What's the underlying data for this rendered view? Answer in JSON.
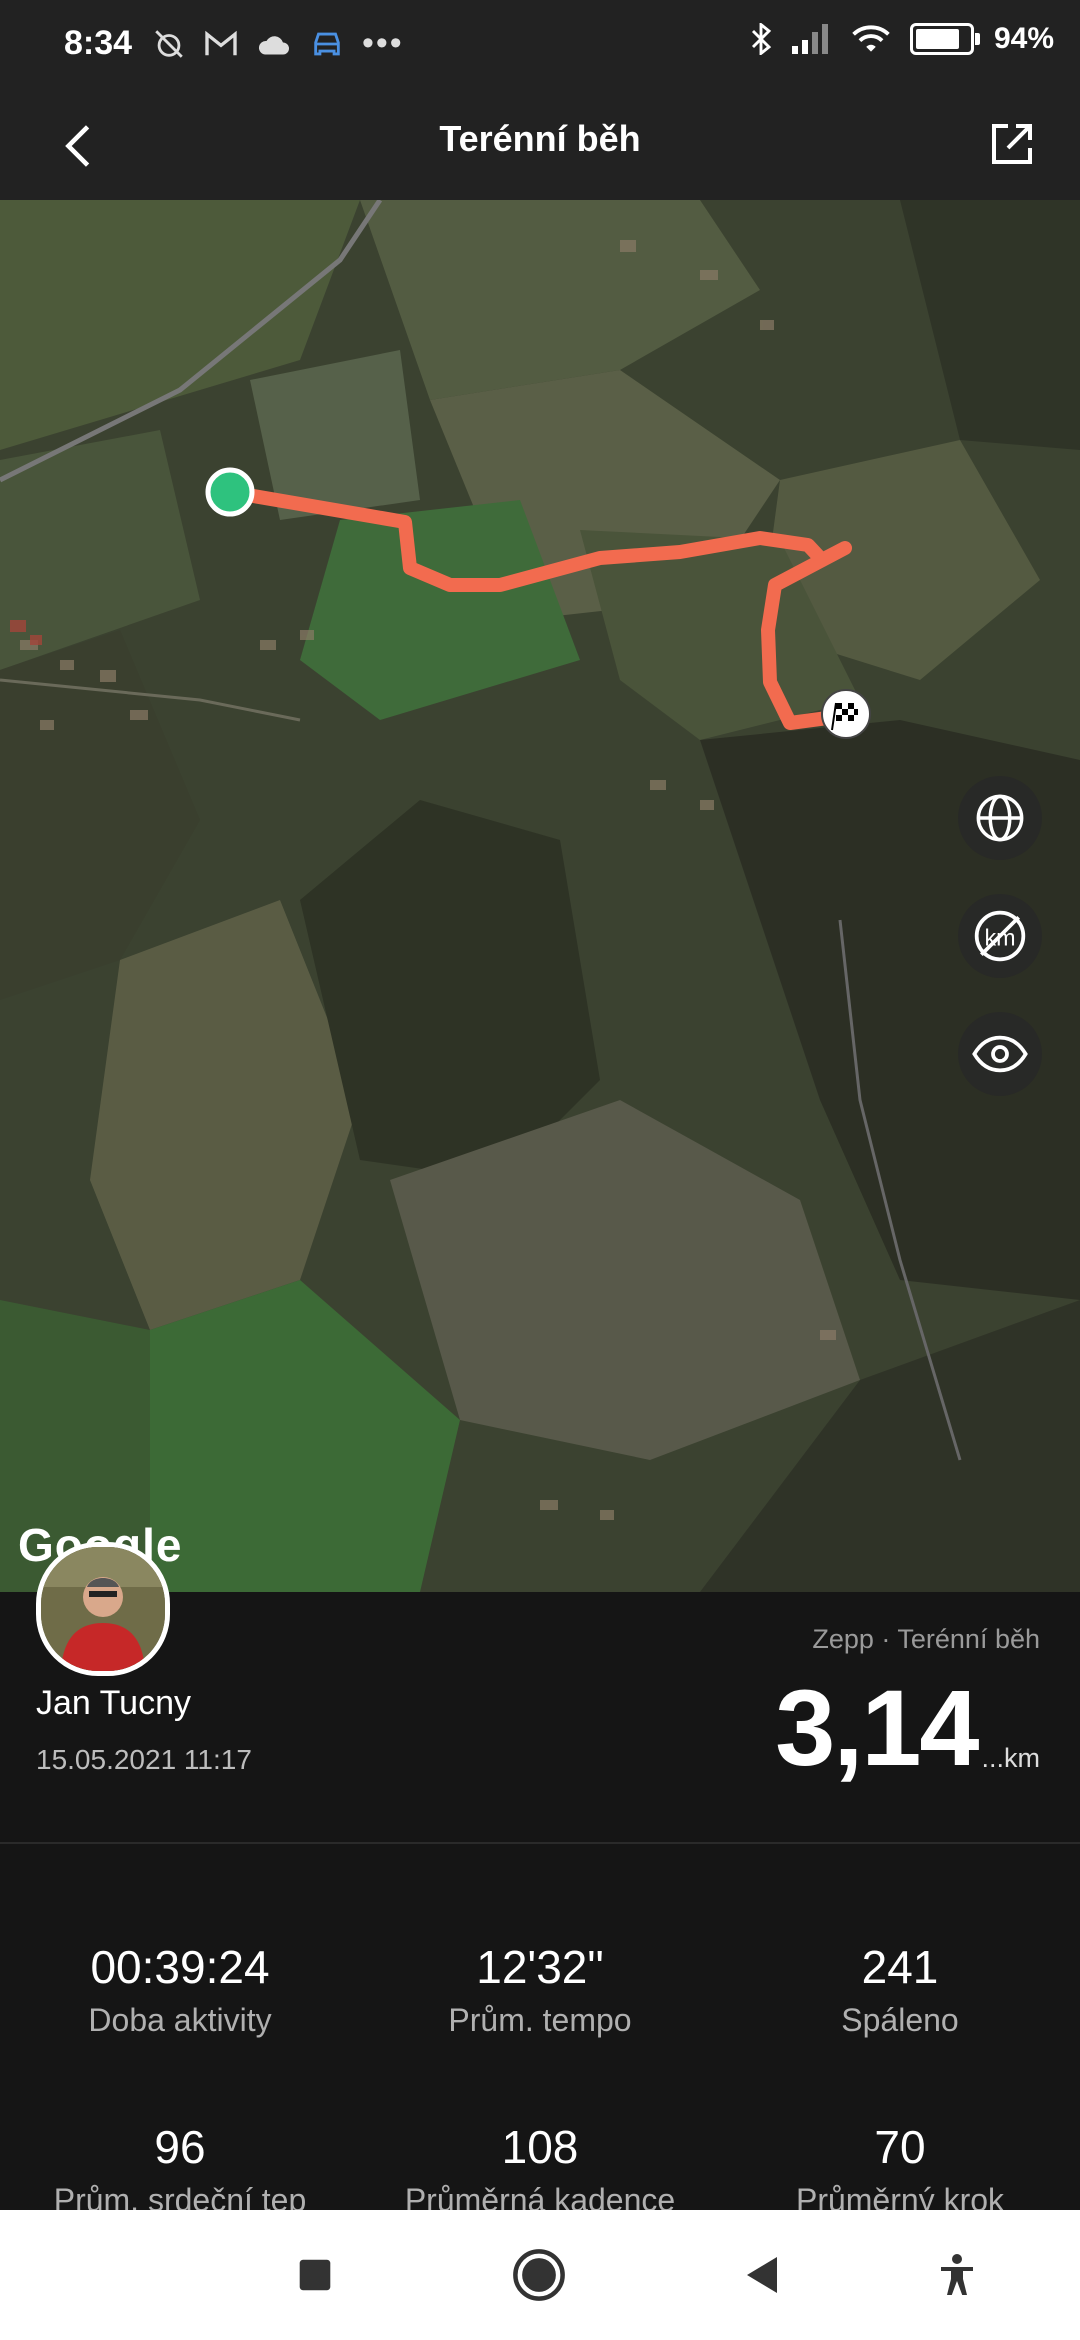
{
  "status_bar": {
    "time": "8:34",
    "battery": "94%",
    "battery_level": 0.94,
    "icons_left": [
      "alarm-off-icon",
      "gmail-icon",
      "cloud-icon",
      "car-icon",
      "more-dots-icon"
    ],
    "icons_right": [
      "bluetooth-icon",
      "signal-icon",
      "wifi-icon",
      "battery-icon"
    ]
  },
  "header": {
    "title": "Terénní běh",
    "back_icon": "chevron-left-icon",
    "share_icon": "share-icon"
  },
  "map": {
    "provider": "Google",
    "route_color": "#f26b4f",
    "start_color": "#2ec27e",
    "controls": [
      "globe-icon",
      "km-off-icon",
      "eye-icon"
    ]
  },
  "activity": {
    "user_name": "Jan Tucny",
    "datetime": "15.05.2021 11:17",
    "source": "Zepp · Terénní běh",
    "distance": "3,14",
    "distance_unit": "...km"
  },
  "stats": [
    {
      "value": "00:39:24",
      "label": "Doba aktivity"
    },
    {
      "value": "12'32\"",
      "label": "Prům. tempo"
    },
    {
      "value": "241",
      "label": "Spáleno"
    },
    {
      "value": "96",
      "label": "Prům. srdeční tep"
    },
    {
      "value": "108",
      "label": "Průměrná kadence"
    },
    {
      "value": "70",
      "label": "Průměrný krok"
    }
  ],
  "navbar": [
    "recents-icon",
    "home-icon",
    "back-icon",
    "accessibility-icon"
  ]
}
